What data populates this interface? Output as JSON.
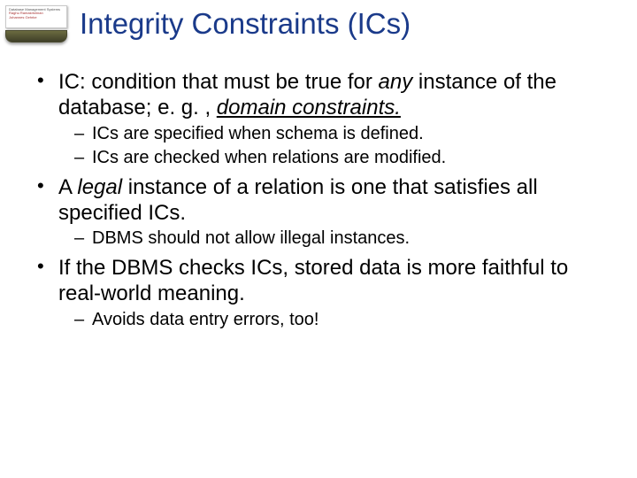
{
  "logo": {
    "line1": "Database Management Systems",
    "line2": "Raghu Ramakrishnan",
    "line3": "Johannes Gehrke"
  },
  "title": "Integrity Constraints (ICs)",
  "bullets": [
    {
      "pre": "IC: condition that must be true for ",
      "em1": "any",
      "mid": " instance of the database; e. g. , ",
      "em2": "domain constraints.",
      "subs": [
        "ICs are specified when schema is defined.",
        "ICs are checked when relations are modified."
      ]
    },
    {
      "pre": "A ",
      "em1": "legal",
      "mid": " instance of a relation is one that satisfies all specified ICs.",
      "em2": "",
      "subs": [
        "DBMS should not allow illegal instances."
      ]
    },
    {
      "pre": "If the DBMS checks ICs, stored data is more faithful to real-world meaning.",
      "em1": "",
      "mid": "",
      "em2": "",
      "subs": [
        "Avoids data entry errors, too!"
      ]
    }
  ]
}
